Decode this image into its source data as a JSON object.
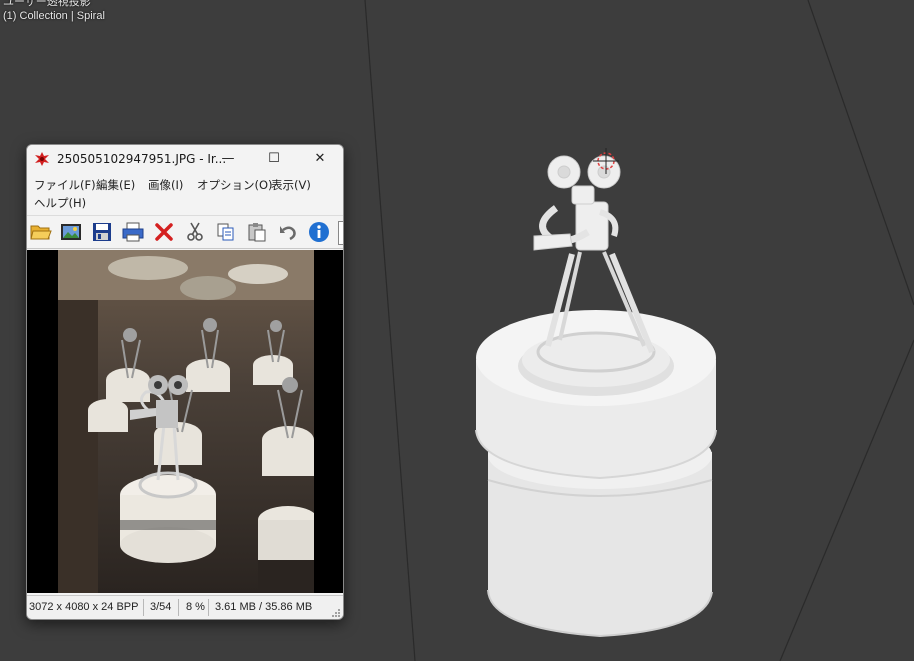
{
  "viewport": {
    "view_name": "ユーザー透視投影",
    "collection_label": "(1) Collection | Spiral"
  },
  "irfanview": {
    "title": "250505102947951.JPG - Ir...",
    "window_controls": {
      "minimize": "—",
      "maximize": "☐",
      "close": "✕"
    },
    "menu": [
      "ファイル(F)",
      "編集(E)",
      "画像(I)",
      "オプション(O)",
      "表示(V)",
      "ヘルプ(H)"
    ],
    "toolbar": [
      "open-folder-icon",
      "thumbnails-icon",
      "save-icon",
      "print-icon",
      "delete-icon",
      "cut-icon",
      "copy-icon",
      "paste-icon",
      "undo-icon",
      "info-icon"
    ],
    "status": {
      "dimensions": "3072 x 4080 x 24 BPP",
      "index": "3/54",
      "zoom": "8 %",
      "size": "3.61 MB / 35.86 MB"
    }
  },
  "colors": {
    "viewport_bg": "#3d3d3d",
    "model_fill": "#e8e8e8",
    "window_bg": "#f3f3f3",
    "info_icon": "#1f6fd1",
    "delete_icon": "#d42020"
  }
}
